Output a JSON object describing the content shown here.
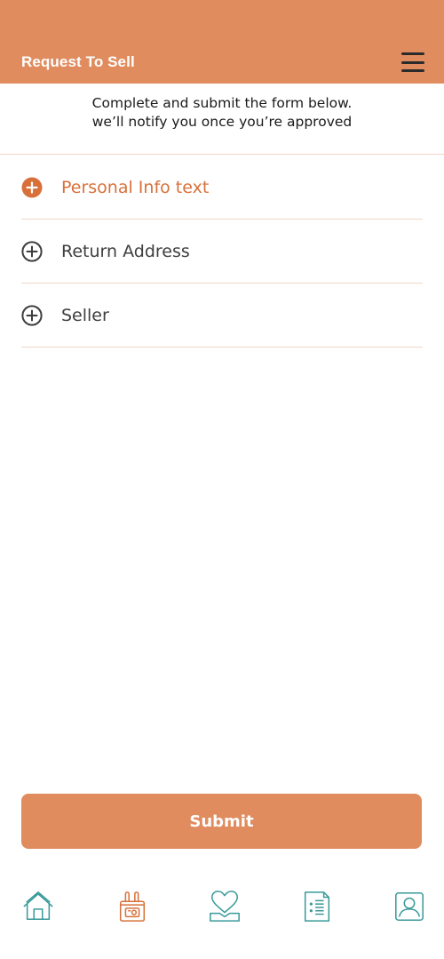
{
  "header": {
    "title": "Request To Sell",
    "menu_icon": "hamburger-menu-icon"
  },
  "intro": {
    "line1": "Complete and submit the form below.",
    "line2": "we’ll notify you once you’re approved"
  },
  "sections": [
    {
      "label": "Personal Info text",
      "active": true,
      "icon": "plus-circle-icon"
    },
    {
      "label": "Return Address",
      "active": false,
      "icon": "plus-circle-icon"
    },
    {
      "label": "Seller",
      "active": false,
      "icon": "plus-circle-icon"
    }
  ],
  "submit": {
    "label": "Submit"
  },
  "tabbar": {
    "tabs": [
      {
        "icon": "home-icon",
        "active": false
      },
      {
        "icon": "sell-bag-icon",
        "active": true
      },
      {
        "icon": "favorites-heart-icon",
        "active": false
      },
      {
        "icon": "list-document-icon",
        "active": false
      },
      {
        "icon": "profile-icon",
        "active": false
      }
    ]
  },
  "colors": {
    "brand_orange": "#e08c5e",
    "active_text": "#d8703a",
    "tab_teal": "#3a9a9a",
    "divider": "#efd7c8"
  }
}
